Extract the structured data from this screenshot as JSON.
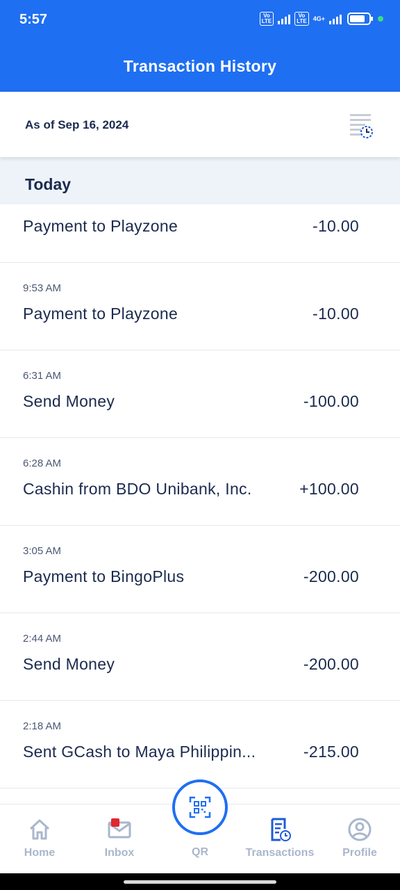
{
  "status_bar": {
    "time": "5:57",
    "volte_label": "Vo LTE",
    "network": "4G+",
    "battery_percent": 80
  },
  "header": {
    "title": "Transaction History"
  },
  "summary": {
    "as_of": "As of Sep 16, 2024",
    "history_icon": "document-clock-icon"
  },
  "section": {
    "label": "Today"
  },
  "transactions": [
    {
      "time": "",
      "description": "Payment to Playzone",
      "amount": "-10.00"
    },
    {
      "time": "9:53 AM",
      "description": "Payment to Playzone",
      "amount": "-10.00"
    },
    {
      "time": "6:31 AM",
      "description": "Send Money",
      "amount": "-100.00"
    },
    {
      "time": "6:28 AM",
      "description": "Cashin from BDO Unibank, Inc.",
      "amount": "+100.00"
    },
    {
      "time": "3:05 AM",
      "description": "Payment to BingoPlus",
      "amount": "-200.00"
    },
    {
      "time": "2:44 AM",
      "description": "Send Money",
      "amount": "-200.00"
    },
    {
      "time": "2:18 AM",
      "description": "Sent GCash to Maya Philippin...",
      "amount": "-215.00"
    }
  ],
  "bottom_nav": {
    "home": "Home",
    "inbox": "Inbox",
    "qr": "QR",
    "transactions": "Transactions",
    "profile": "Profile",
    "active": "transactions"
  },
  "colors": {
    "primary": "#1f6ff2",
    "text": "#1b2a4e",
    "inactive": "#aab6cc",
    "active": "#1c5bd8",
    "badge": "#e3262f"
  }
}
